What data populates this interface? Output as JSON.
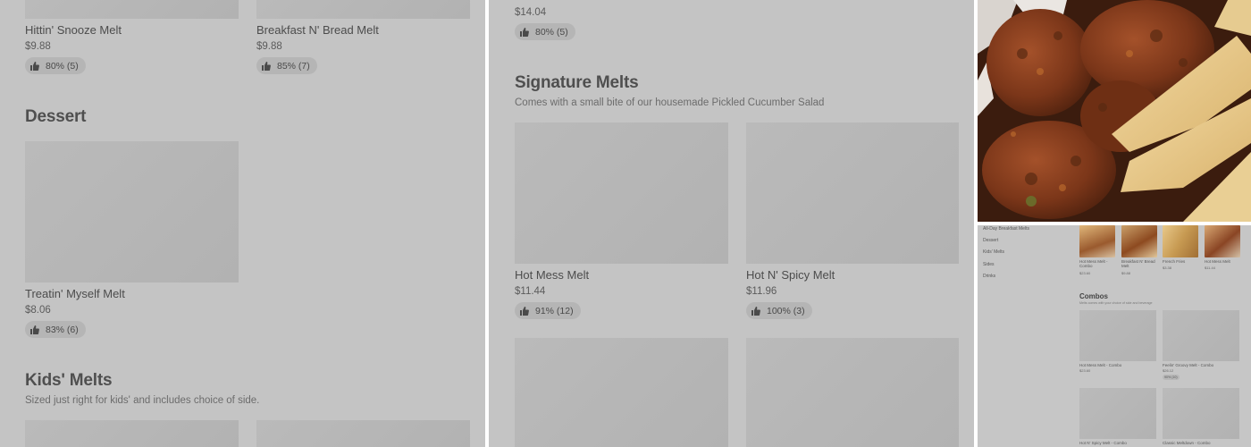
{
  "panel_left": {
    "top_items": [
      {
        "name": "Hittin' Snooze Melt",
        "price": "$9.88",
        "rating": "80% (5)"
      },
      {
        "name": "Breakfast N' Bread Melt",
        "price": "$9.88",
        "rating": "85% (7)"
      }
    ],
    "dessert": {
      "title": "Dessert",
      "items": [
        {
          "name": "Treatin' Myself Melt",
          "price": "$8.06",
          "rating": "83% (6)"
        }
      ]
    },
    "kids": {
      "title": "Kids' Melts",
      "subtitle": "Sized just right for kids' and includes choice of side."
    }
  },
  "panel_middle": {
    "top_item": {
      "price": "$14.04",
      "rating": "80% (5)"
    },
    "signature": {
      "title": "Signature Melts",
      "subtitle": "Comes with a small bite of our housemade Pickled Cucumber Salad",
      "items": [
        {
          "name": "Hot Mess Melt",
          "price": "$11.44",
          "rating": "91% (12)"
        },
        {
          "name": "Hot N' Spicy Melt",
          "price": "$11.96",
          "rating": "100% (3)"
        }
      ]
    }
  },
  "panel_mini": {
    "sidebar": [
      "All-Day Breakfast Melts",
      "Dessert",
      "Kids' Melts",
      "Sides",
      "Drinks"
    ],
    "featured": [
      {
        "name": "Hot Mess Melt - Combo",
        "price": "$23.60"
      },
      {
        "name": "Breakfast N' Bread Melt",
        "price": "$9.88"
      },
      {
        "name": "French Fries",
        "price": "$3.38"
      },
      {
        "name": "Hot Mess Melt",
        "price": "$11.44"
      }
    ],
    "combos": {
      "title": "Combos",
      "subtitle": "Melts comes with your choice of side and beverage",
      "items": [
        {
          "name": "Hot Mess Melt - Combo",
          "price": "$23.60",
          "rating": ""
        },
        {
          "name": "Feelin' Groovy Melt - Combo",
          "price": "$26.12",
          "rating": "90% (10)"
        },
        {
          "name": "Hot N' Spicy Melt - Combo",
          "price": ""
        },
        {
          "name": "Classic Meltdown - Combo",
          "price": ""
        }
      ]
    }
  },
  "colors": {
    "overlay": "#c4c4c4",
    "placeholder": "#b8b8b8",
    "rating_pill": "#b5b5b5",
    "text_dark": "#4c4c4c"
  },
  "icons": [
    "thumbs-up-icon"
  ]
}
